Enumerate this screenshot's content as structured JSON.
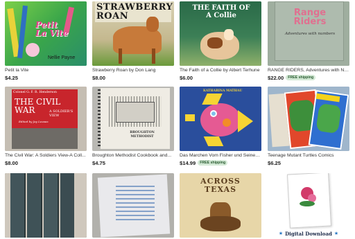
{
  "listings": [
    {
      "title": "Petit la Vite",
      "price": "$4.25",
      "cover": {
        "main": "Petit\nLa Vite",
        "author": "Nellie Payne"
      }
    },
    {
      "title": "Strawberry Roan by Don Lang",
      "price": "$8.00",
      "cover": {
        "main": "STRAWBERRY\nROAN"
      }
    },
    {
      "title": "The Faith of a Collie by Albert Terhune",
      "price": "$6.00",
      "cover": {
        "main": "THE FAITH OF\nA Collie"
      }
    },
    {
      "title": "RANGE RIDERS, Adventures with Nu...",
      "price": "$22.00",
      "badge": "FREE shipping",
      "cover": {
        "main": "Range\nRiders",
        "sub": "Adventures with numbers"
      }
    },
    {
      "title": "The Civil War: A Soldiers View-A Coll...",
      "price": "$8.00",
      "cover": {
        "top": "Colonel G. F. R. Henderson",
        "main": "THE CIVIL\nWAR",
        "side": "A SOLDIER'S VIEW",
        "editor": "Edited by Jay Luvaas"
      }
    },
    {
      "title": "Broughton Methodist Cookbook and...",
      "price": "$4.75",
      "cover": {
        "main": "BROUGHTON\nMETHODIST"
      }
    },
    {
      "title": "Das Marchen Vom Fisher und Seiner ...",
      "price": "$14.99",
      "badge": "FREE shipping",
      "cover": {
        "main": "KATHARINA MATHAU"
      }
    },
    {
      "title": "Teenage Mutant Turtles Comics",
      "price": "$6.25",
      "cover": {}
    },
    {
      "cover": {}
    },
    {
      "cover": {}
    },
    {
      "cover": {
        "main": "ACROSS\nTEXAS"
      }
    },
    {
      "cover": {
        "digital": "Digital Download"
      }
    }
  ],
  "colors": {
    "badge_bg": "#d4e9d6",
    "badge_text": "#2a5d31",
    "price": "#222222"
  }
}
